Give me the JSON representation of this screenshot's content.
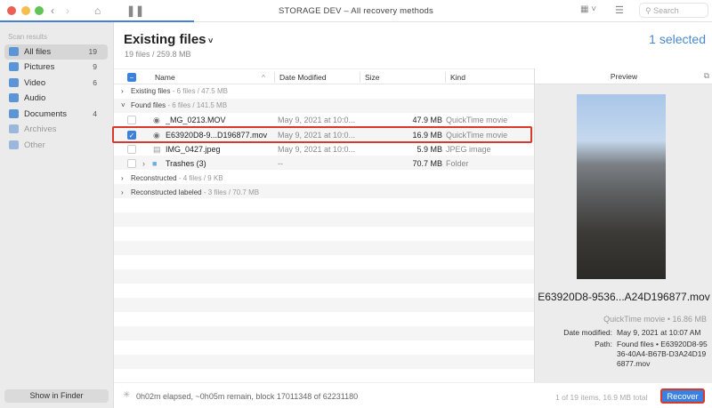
{
  "window": {
    "title": "STORAGE DEV – All recovery methods",
    "search_placeholder": "Search"
  },
  "colors": {
    "accent": "#3b82e0",
    "highlight": "#d9382a"
  },
  "sidebar": {
    "heading": "Scan results",
    "items": [
      {
        "label": "All files",
        "count": "19",
        "icon": "all-files-icon"
      },
      {
        "label": "Pictures",
        "count": "9",
        "icon": "pictures-icon"
      },
      {
        "label": "Video",
        "count": "6",
        "icon": "video-icon"
      },
      {
        "label": "Audio",
        "count": "",
        "icon": "audio-icon"
      },
      {
        "label": "Documents",
        "count": "4",
        "icon": "documents-icon"
      },
      {
        "label": "Archives",
        "count": "",
        "icon": "archives-icon"
      },
      {
        "label": "Other",
        "count": "",
        "icon": "other-icon"
      }
    ],
    "show_in_finder": "Show in Finder"
  },
  "header": {
    "title": "Existing files",
    "subtitle": "19 files / 259.8 MB",
    "selected": "1 selected"
  },
  "table": {
    "columns": [
      "Name",
      "Date Modified",
      "Size",
      "Kind"
    ],
    "groups": {
      "existing": {
        "label": "Existing files",
        "meta": " - 6 files / 47.5 MB"
      },
      "found": {
        "label": "Found files",
        "meta": " - 6 files / 141.5 MB"
      },
      "reconstructed": {
        "label": "Reconstructed",
        "meta": " - 4 files / 9 KB"
      },
      "labeled": {
        "label": "Reconstructed labeled",
        "meta": " - 3 files / 70.7 MB"
      }
    },
    "rows": [
      {
        "name": "_MG_0213.MOV",
        "date": "May 9, 2021 at 10:0...",
        "size": "47.9 MB",
        "kind": "QuickTime movie"
      },
      {
        "name": "E63920D8-9...D196877.mov",
        "date": "May 9, 2021 at 10:0...",
        "size": "16.9 MB",
        "kind": "QuickTime movie"
      },
      {
        "name": "IMG_0427.jpeg",
        "date": "May 9, 2021 at 10:0...",
        "size": "5.9 MB",
        "kind": "JPEG image"
      },
      {
        "name": "Trashes (3)",
        "date": "--",
        "size": "70.7 MB",
        "kind": "Folder"
      }
    ]
  },
  "preview": {
    "heading": "Preview",
    "name": "E63920D8-9536...A24D196877.mov",
    "kind": "QuickTime movie • 16.86 MB",
    "date_label": "Date modified:",
    "date": "May 9, 2021 at 10:07 AM",
    "path_label": "Path:",
    "path": "Found files • E63920D8-9536-40A4-B67B-D3A24D196877.mov"
  },
  "footer": {
    "status": "0h02m elapsed, ~0h05m remain, block 17011348 of 62231180",
    "count": "1 of 19 items, 16.9 MB total",
    "recover": "Recover"
  }
}
